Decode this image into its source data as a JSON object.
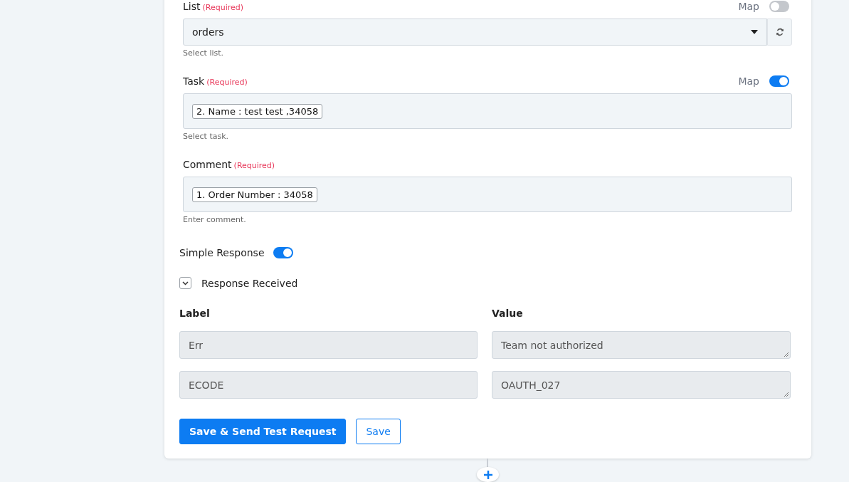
{
  "fields": [
    {
      "kind": "select",
      "label": "List",
      "required": "(Required)",
      "map": {
        "label": "Map",
        "on": false
      },
      "value": "orders",
      "hint": "Select list."
    },
    {
      "kind": "mapped",
      "label": "Task",
      "required": "(Required)",
      "map": {
        "label": "Map",
        "on": true
      },
      "token": "2. Name : test test ,34058",
      "hint": "Select task."
    },
    {
      "kind": "mapped",
      "label": "Comment",
      "required": "(Required)",
      "token": "1. Order Number : 34058",
      "hint": "Enter comment."
    }
  ],
  "simple_response": {
    "label": "Simple Response",
    "on": true
  },
  "response": {
    "label": "Response Received",
    "expanded": true,
    "columns": [
      "Label",
      "Value"
    ],
    "rows": [
      {
        "label": "Err",
        "value": "Team not authorized"
      },
      {
        "label": "ECODE",
        "value": "OAUTH_027"
      }
    ]
  },
  "buttons": [
    {
      "kind": "primary",
      "label": "Save & Send Test Request"
    },
    {
      "kind": "outline",
      "label": "Save"
    }
  ]
}
